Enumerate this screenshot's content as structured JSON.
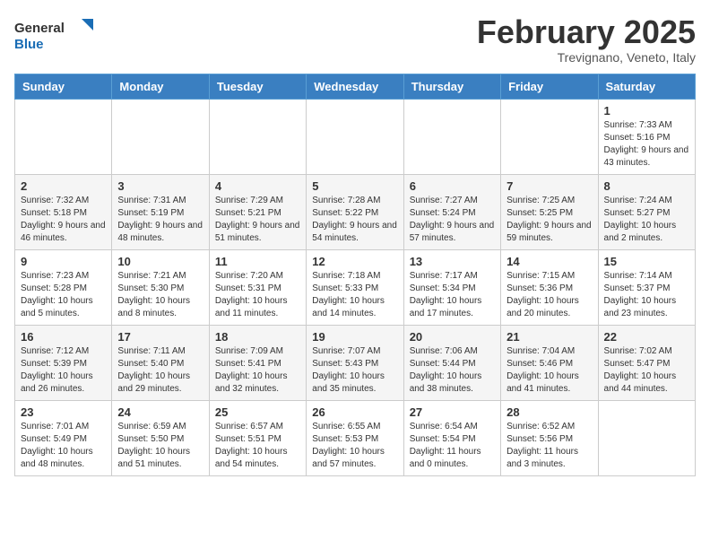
{
  "header": {
    "logo_line1": "General",
    "logo_line2": "Blue",
    "month_title": "February 2025",
    "location": "Trevignano, Veneto, Italy"
  },
  "days_of_week": [
    "Sunday",
    "Monday",
    "Tuesday",
    "Wednesday",
    "Thursday",
    "Friday",
    "Saturday"
  ],
  "weeks": [
    [
      {
        "day": "",
        "info": ""
      },
      {
        "day": "",
        "info": ""
      },
      {
        "day": "",
        "info": ""
      },
      {
        "day": "",
        "info": ""
      },
      {
        "day": "",
        "info": ""
      },
      {
        "day": "",
        "info": ""
      },
      {
        "day": "1",
        "info": "Sunrise: 7:33 AM\nSunset: 5:16 PM\nDaylight: 9 hours and 43 minutes."
      }
    ],
    [
      {
        "day": "2",
        "info": "Sunrise: 7:32 AM\nSunset: 5:18 PM\nDaylight: 9 hours and 46 minutes."
      },
      {
        "day": "3",
        "info": "Sunrise: 7:31 AM\nSunset: 5:19 PM\nDaylight: 9 hours and 48 minutes."
      },
      {
        "day": "4",
        "info": "Sunrise: 7:29 AM\nSunset: 5:21 PM\nDaylight: 9 hours and 51 minutes."
      },
      {
        "day": "5",
        "info": "Sunrise: 7:28 AM\nSunset: 5:22 PM\nDaylight: 9 hours and 54 minutes."
      },
      {
        "day": "6",
        "info": "Sunrise: 7:27 AM\nSunset: 5:24 PM\nDaylight: 9 hours and 57 minutes."
      },
      {
        "day": "7",
        "info": "Sunrise: 7:25 AM\nSunset: 5:25 PM\nDaylight: 9 hours and 59 minutes."
      },
      {
        "day": "8",
        "info": "Sunrise: 7:24 AM\nSunset: 5:27 PM\nDaylight: 10 hours and 2 minutes."
      }
    ],
    [
      {
        "day": "9",
        "info": "Sunrise: 7:23 AM\nSunset: 5:28 PM\nDaylight: 10 hours and 5 minutes."
      },
      {
        "day": "10",
        "info": "Sunrise: 7:21 AM\nSunset: 5:30 PM\nDaylight: 10 hours and 8 minutes."
      },
      {
        "day": "11",
        "info": "Sunrise: 7:20 AM\nSunset: 5:31 PM\nDaylight: 10 hours and 11 minutes."
      },
      {
        "day": "12",
        "info": "Sunrise: 7:18 AM\nSunset: 5:33 PM\nDaylight: 10 hours and 14 minutes."
      },
      {
        "day": "13",
        "info": "Sunrise: 7:17 AM\nSunset: 5:34 PM\nDaylight: 10 hours and 17 minutes."
      },
      {
        "day": "14",
        "info": "Sunrise: 7:15 AM\nSunset: 5:36 PM\nDaylight: 10 hours and 20 minutes."
      },
      {
        "day": "15",
        "info": "Sunrise: 7:14 AM\nSunset: 5:37 PM\nDaylight: 10 hours and 23 minutes."
      }
    ],
    [
      {
        "day": "16",
        "info": "Sunrise: 7:12 AM\nSunset: 5:39 PM\nDaylight: 10 hours and 26 minutes."
      },
      {
        "day": "17",
        "info": "Sunrise: 7:11 AM\nSunset: 5:40 PM\nDaylight: 10 hours and 29 minutes."
      },
      {
        "day": "18",
        "info": "Sunrise: 7:09 AM\nSunset: 5:41 PM\nDaylight: 10 hours and 32 minutes."
      },
      {
        "day": "19",
        "info": "Sunrise: 7:07 AM\nSunset: 5:43 PM\nDaylight: 10 hours and 35 minutes."
      },
      {
        "day": "20",
        "info": "Sunrise: 7:06 AM\nSunset: 5:44 PM\nDaylight: 10 hours and 38 minutes."
      },
      {
        "day": "21",
        "info": "Sunrise: 7:04 AM\nSunset: 5:46 PM\nDaylight: 10 hours and 41 minutes."
      },
      {
        "day": "22",
        "info": "Sunrise: 7:02 AM\nSunset: 5:47 PM\nDaylight: 10 hours and 44 minutes."
      }
    ],
    [
      {
        "day": "23",
        "info": "Sunrise: 7:01 AM\nSunset: 5:49 PM\nDaylight: 10 hours and 48 minutes."
      },
      {
        "day": "24",
        "info": "Sunrise: 6:59 AM\nSunset: 5:50 PM\nDaylight: 10 hours and 51 minutes."
      },
      {
        "day": "25",
        "info": "Sunrise: 6:57 AM\nSunset: 5:51 PM\nDaylight: 10 hours and 54 minutes."
      },
      {
        "day": "26",
        "info": "Sunrise: 6:55 AM\nSunset: 5:53 PM\nDaylight: 10 hours and 57 minutes."
      },
      {
        "day": "27",
        "info": "Sunrise: 6:54 AM\nSunset: 5:54 PM\nDaylight: 11 hours and 0 minutes."
      },
      {
        "day": "28",
        "info": "Sunrise: 6:52 AM\nSunset: 5:56 PM\nDaylight: 11 hours and 3 minutes."
      },
      {
        "day": "",
        "info": ""
      }
    ]
  ]
}
